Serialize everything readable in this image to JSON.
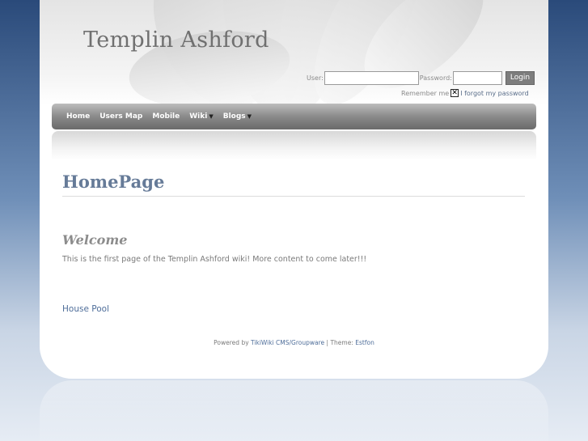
{
  "site": {
    "title": "Templin Ashford"
  },
  "login": {
    "user_label": "User:",
    "password_label": "Password:",
    "login_button": "Login",
    "remember_label": "Remember me",
    "forgot_link": "I forgot my password"
  },
  "nav": {
    "items": [
      {
        "label": "Home",
        "dropdown": false
      },
      {
        "label": "Users Map",
        "dropdown": false
      },
      {
        "label": "Mobile",
        "dropdown": false
      },
      {
        "label": "Wiki",
        "dropdown": true
      },
      {
        "label": "Blogs",
        "dropdown": true
      }
    ]
  },
  "content": {
    "page_title": "HomePage",
    "welcome_heading": "Welcome",
    "intro_text": "This is the first page of the Templin Ashford wiki! More content to come later!!!",
    "house_link": "House Pool"
  },
  "footer": {
    "powered_by": "Powered by",
    "cms_link": "TikiWiki CMS/Groupware",
    "separator": " | ",
    "theme_label": "Theme:",
    "theme_name": "Estfon"
  },
  "colors": {
    "accent_link": "#4f6e9a",
    "heading": "#667b98",
    "nav_bg": "#8a8a8a"
  }
}
